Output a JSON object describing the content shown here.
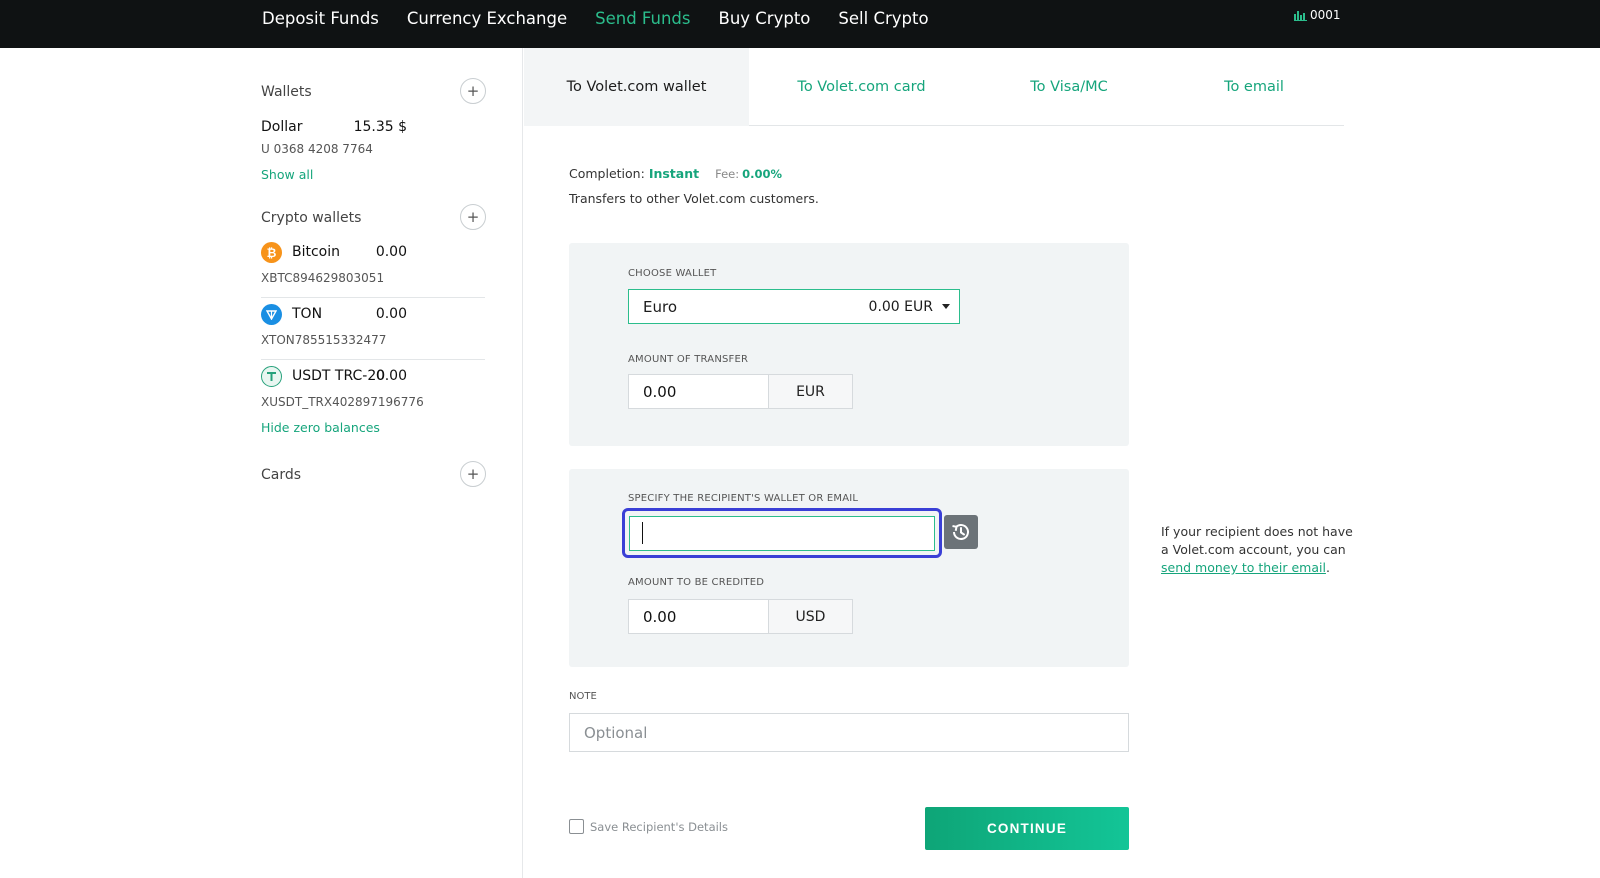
{
  "topnav": {
    "items": [
      "Deposit Funds",
      "Currency Exchange",
      "Send Funds",
      "Buy Crypto",
      "Sell Crypto"
    ],
    "active": "Send Funds",
    "account_id": "0001"
  },
  "sidebar": {
    "wallets_heading": "Wallets",
    "dollar": {
      "name": "Dollar",
      "amount": "15.35 $",
      "number": "U 0368 4208 7764"
    },
    "show_all": "Show all",
    "crypto_heading": "Crypto wallets",
    "crypto": [
      {
        "name": "Bitcoin",
        "amount": "0.00",
        "address": "XBTC894629803051",
        "icon": "bitcoin-icon",
        "color": "#f7931a"
      },
      {
        "name": "TON",
        "amount": "0.00",
        "address": "XTON785515332477",
        "icon": "ton-icon",
        "color": "#1a8fe3"
      },
      {
        "name": "USDT TRC-20",
        "amount": "0.00",
        "address": "XUSDT_TRX402897196776",
        "icon": "tether-icon",
        "color": "#26a17b"
      }
    ],
    "hide_zero": "Hide zero balances",
    "cards_heading": "Cards"
  },
  "tabs": [
    "To Volet.com wallet",
    "To Volet.com card",
    "To Visa/MC",
    "To email"
  ],
  "info": {
    "completion_label": "Completion:",
    "completion_value": "Instant",
    "fee_label": "Fee:",
    "fee_value": "0.00%",
    "description": "Transfers to other Volet.com customers."
  },
  "form": {
    "choose_wallet_label": "CHOOSE WALLET",
    "wallet_selected": "Euro",
    "wallet_balance": "0.00 EUR",
    "amount_transfer_label": "AMOUNT OF TRANSFER",
    "amount_transfer_value": "0.00",
    "amount_transfer_currency": "EUR",
    "recipient_label": "SPECIFY THE RECIPIENT'S WALLET OR EMAIL",
    "recipient_value": "",
    "amount_credited_label": "AMOUNT TO BE CREDITED",
    "amount_credited_value": "0.00",
    "amount_credited_currency": "USD",
    "note_label": "NOTE",
    "note_placeholder": "Optional",
    "save_label": "Save Recipient's Details",
    "continue_label": "CONTINUE"
  },
  "side_note": {
    "text": "If your recipient does not have a Volet.com account, you can",
    "link": "send money to their email",
    "suffix": "."
  },
  "colors": {
    "accent": "#16a57c",
    "topbar": "#0f1213",
    "focus_ring": "#3a3fd6"
  }
}
